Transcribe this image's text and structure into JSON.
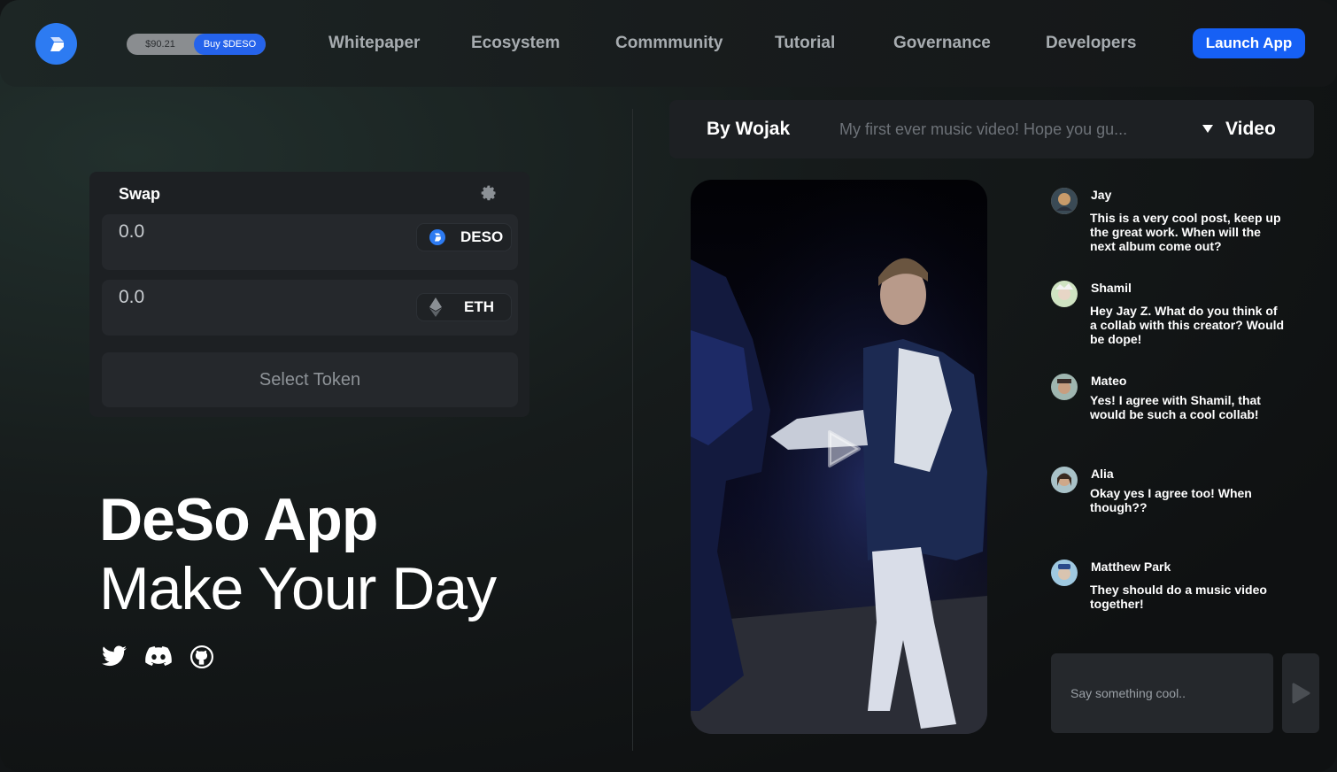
{
  "nav": {
    "price": "$90.21",
    "buy_label": "Buy $DESO",
    "links": [
      "Whitepaper",
      "Ecosystem",
      "Commmunity",
      "Tutorial",
      "Governance",
      "Developers"
    ],
    "launch_label": "Launch App"
  },
  "swap": {
    "title": "Swap",
    "from": {
      "amount": "0.0",
      "token": "DESO"
    },
    "to": {
      "amount": "0.0",
      "token": "ETH"
    },
    "select_label": "Select Token"
  },
  "hero": {
    "title": "DeSo App",
    "subtitle": "Make Your Day",
    "socials": [
      "twitter-icon",
      "discord-icon",
      "github-icon"
    ]
  },
  "post": {
    "author": "By Wojak",
    "caption": "My first ever music video! Hope you gu...",
    "type": "Video"
  },
  "comments": [
    {
      "name": "Jay",
      "text": "This is a very cool post, keep up the great work. When will the next album come out?",
      "avatar_color": "#b08a5a"
    },
    {
      "name": "Shamil",
      "text": "Hey Jay Z. What do you think of a collab with this creator? Would be dope!",
      "avatar_color": "#cfe3c2"
    },
    {
      "name": "Mateo",
      "text": "Yes! I agree with Shamil, that would be such a cool collab!",
      "avatar_color": "#9fb6b0"
    },
    {
      "name": "Alia",
      "text": "Okay yes I agree too! When though??",
      "avatar_color": "#a9c2c8"
    },
    {
      "name": "Matthew Park",
      "text": "They should do a music video together!",
      "avatar_color": "#9fc8e0"
    }
  ],
  "comment_input": {
    "placeholder": "Say something cool.."
  },
  "colors": {
    "accent": "#1660f5",
    "panel": "#1d2023",
    "field": "#25282c"
  }
}
